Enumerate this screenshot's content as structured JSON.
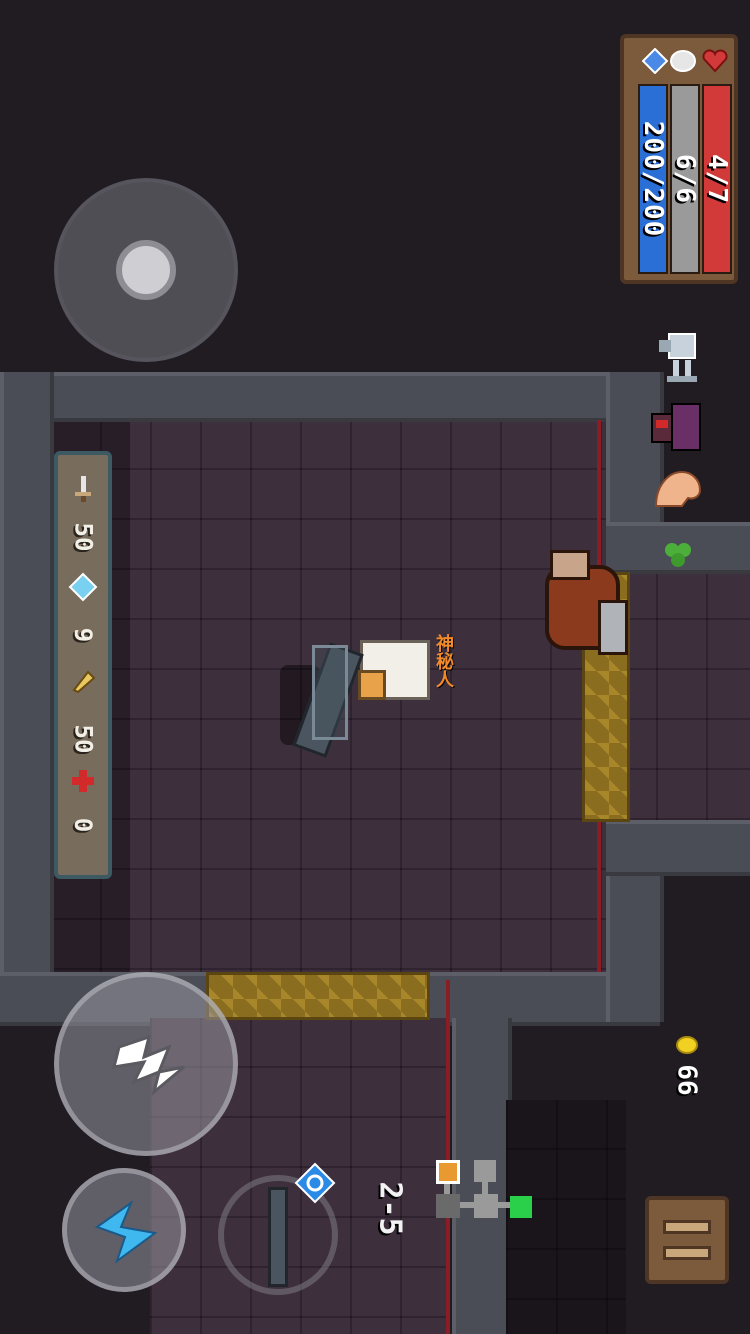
{
  "status": {
    "energy": "200/200",
    "armor": "6/6",
    "health": "4/7",
    "energy_color": "#2a6fd6",
    "armor_color": "#9a9a9a",
    "health_color": "#d23a3a"
  },
  "resources": {
    "items": [
      {
        "icon": "dagger-icon",
        "value": "50"
      },
      {
        "icon": "gem-icon",
        "value": "9"
      },
      {
        "icon": "bullet-icon",
        "value": "50"
      },
      {
        "icon": "medkit-icon",
        "value": "0"
      }
    ]
  },
  "buffs": [
    "trophy-icon",
    "hat-icon",
    "strength-icon",
    "clover-icon"
  ],
  "gold": {
    "value": "66"
  },
  "level": {
    "label": "2-5"
  },
  "controls": {
    "attack": "attack-button",
    "skill": "skill-button",
    "weapon_swap": "weapon-swap-button",
    "pause": "pause-button",
    "joystick": "joystick"
  },
  "player": {
    "tag": "神秘人"
  }
}
